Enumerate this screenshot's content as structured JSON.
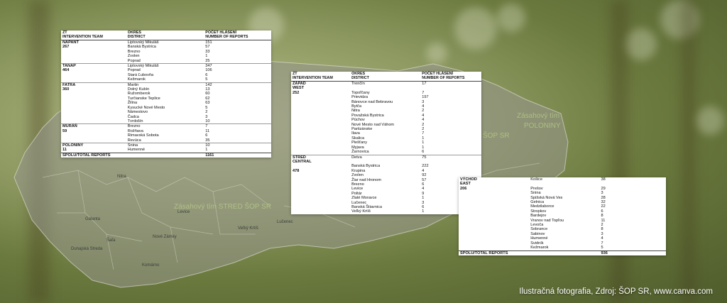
{
  "tables": [
    {
      "headers": [
        "ZT\nINTERVENTION TEAM",
        "OKRES\nDISTRICT",
        "POČET HLÁSENÍ\nNUMBER OF REPORTS"
      ],
      "groups": [
        {
          "team": "NAPANT",
          "team_total": "267",
          "rows": [
            [
              "Liptovský Mikuláš",
              "151"
            ],
            [
              "Banská Bystrica",
              "57"
            ],
            [
              "Brezno",
              "33"
            ],
            [
              "Zvolen",
              "1"
            ],
            [
              "Poprad",
              "25"
            ]
          ]
        },
        {
          "team": "TANAP",
          "team_total": "464",
          "rows": [
            [
              "Liptovský Mikuláš",
              "347"
            ],
            [
              "Poprad",
              "106"
            ],
            [
              "Stará Ľubovňa",
              "6"
            ],
            [
              "Kežmarok",
              "5"
            ]
          ]
        },
        {
          "team": "FATRA",
          "team_total": "360",
          "rows": [
            [
              "Martin",
              "142"
            ],
            [
              "Dolný Kubín",
              "13"
            ],
            [
              "Ružomberok",
              "60"
            ],
            [
              "Turčianske Teplice",
              "62"
            ],
            [
              "Žilina",
              "63"
            ],
            [
              "Kysucké Nové Mesto",
              "5"
            ],
            [
              "Námestovo",
              "2"
            ],
            [
              "Čadca",
              "3"
            ],
            [
              "Tvrdošín",
              "10"
            ]
          ]
        },
        {
          "team": "MURÁŇ",
          "team_total": "59",
          "rows": [
            [
              "Brezno",
              "7"
            ],
            [
              "Rožňava",
              "11"
            ],
            [
              "Rimavská Sobota",
              "6"
            ],
            [
              "Revúca",
              "35"
            ]
          ]
        },
        {
          "team": "POLONINY",
          "team_total": "11",
          "rows": [
            [
              "Snina",
              "10"
            ],
            [
              "Humenné",
              "1"
            ]
          ]
        }
      ],
      "total": {
        "label": "SPOLU/TOTAL REPORTS",
        "value": "1161"
      }
    },
    {
      "headers": [
        "ZT\nINTERVENTION TEAM",
        "OKRES\nDISTRICT",
        "POČET HLÁSENÍ\nNUMBER OF REPORTS"
      ],
      "groups": [
        {
          "team": "ZÁPAD\nWEST",
          "team_total": "252",
          "rows": [
            [
              "Trenčín",
              "17"
            ],
            [
              "",
              ""
            ],
            [
              "Topoľčany",
              "7"
            ],
            [
              "Prievidza",
              "197"
            ],
            [
              "Bánovce nad Bebravou",
              "3"
            ],
            [
              "Bytča",
              "4"
            ],
            [
              "Nitra",
              "2"
            ],
            [
              "Považská Bystrica",
              "4"
            ],
            [
              "Púchov",
              "4"
            ],
            [
              "Nové Mesto nad Váhom",
              "2"
            ],
            [
              "Partizánske",
              "2"
            ],
            [
              "Ilava",
              "7"
            ],
            [
              "Skalica",
              "1"
            ],
            [
              "Piešťany",
              "1"
            ],
            [
              "Myjava",
              "1"
            ],
            [
              "Žarnovica",
              "6"
            ]
          ]
        },
        {
          "team": "STRED\nCENTRAL",
          "team_total": "478",
          "rows": [
            [
              "Detva",
              "75"
            ],
            [
              "Banská Bystrica",
              "222"
            ],
            [
              "Krupina",
              "4"
            ],
            [
              "Zvolen",
              "92"
            ],
            [
              "Žiar nad Hronom",
              "57"
            ],
            [
              "Brezno",
              "6"
            ],
            [
              "Levice",
              "4"
            ],
            [
              "Poltár",
              "9"
            ],
            [
              "Zlaté Moravce",
              "1"
            ],
            [
              "Lučenec",
              "3"
            ],
            [
              "Banská Štiavnica",
              "6"
            ],
            [
              "Veľký Krtíš",
              "1"
            ]
          ]
        }
      ]
    },
    {
      "groups": [
        {
          "team": "VÝCHOD\nEAST",
          "team_total": "206",
          "rows": [
            [
              "Košice",
              "38"
            ],
            [
              "",
              ""
            ],
            [
              "Prešov",
              "29"
            ],
            [
              "Snina",
              "3"
            ],
            [
              "Spišská Nová Ves",
              "28"
            ],
            [
              "Gelnica",
              "32"
            ],
            [
              "Medzilaborce",
              "22"
            ],
            [
              "Stropkov",
              "6"
            ],
            [
              "Bardejov",
              "8"
            ],
            [
              "Vranov nad Topľou",
              "11"
            ],
            [
              "Levoča",
              "2"
            ],
            [
              "Sobrance",
              "8"
            ],
            [
              "Sabinov",
              "3"
            ],
            [
              "Humenné",
              "4"
            ],
            [
              "Svidník",
              "7"
            ],
            [
              "Kežmarok",
              "5"
            ]
          ]
        }
      ],
      "total": {
        "label": "SPOLU/TOTAL REPORTS",
        "value": "936"
      }
    }
  ],
  "map_labels": {
    "stred": "Zásahový tím STRED ŠOP SR",
    "sop": "ŠOP SR",
    "zasahovy": "Zásahový tím",
    "poloniny": "POLONINY"
  },
  "map_districts": [
    "Nitra",
    "Galanta",
    "Levice",
    "Šaľa",
    "Komárno",
    "Nové Zámky",
    "Dunajská Streda",
    "Veľký Krtíš",
    "Lučenec"
  ],
  "caption": "Ilustračná fotografia, Zdroj: ŠOP SR, www.canva.com"
}
